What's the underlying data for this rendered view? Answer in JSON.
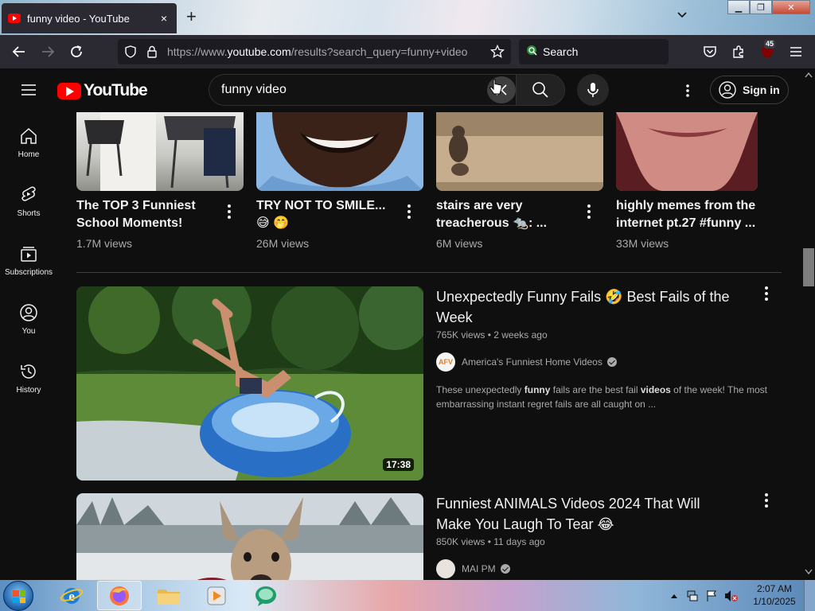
{
  "browser": {
    "tab_title": "funny video - YouTube",
    "tab_close": "×",
    "new_tab": "+",
    "url_prefix": "https://www.",
    "url_host": "youtube.com",
    "url_path": "/results?search_query=funny+video",
    "search_placeholder": "Search",
    "extension_badge": "45"
  },
  "youtube": {
    "logo_text": "YouTube",
    "search_query": "funny video",
    "sign_in": "Sign in",
    "sidebar": [
      {
        "label": "Home",
        "icon": "home-icon"
      },
      {
        "label": "Shorts",
        "icon": "shorts-icon"
      },
      {
        "label": "Subscriptions",
        "icon": "subscriptions-icon"
      },
      {
        "label": "You",
        "icon": "you-icon"
      },
      {
        "label": "History",
        "icon": "history-icon"
      }
    ],
    "shorts": [
      {
        "title": "The TOP 3 Funniest School Moments!",
        "views": "1.7M views"
      },
      {
        "title": "TRY NOT TO SMILE... 😅 🤭",
        "views": "26M views"
      },
      {
        "title": "stairs are very treacherous 🐀: ...",
        "views": "6M views"
      },
      {
        "title": "highly memes from the internet pt.27 #funny ...",
        "views": "33M views"
      }
    ],
    "videos": [
      {
        "title": "Unexpectedly Funny Fails 🤣 Best Fails of the Week",
        "meta": "765K views • 2 weeks ago",
        "channel": "America's Funniest Home Videos",
        "channel_avatar": "AFV",
        "desc_1": "These unexpectedly ",
        "desc_bold_1": "funny",
        "desc_2": " fails are the best fail ",
        "desc_bold_2": "videos",
        "desc_3": " of the week! The most embarrassing instant regret fails are all caught on ...",
        "duration": "17:38"
      },
      {
        "title": "Funniest ANIMALS Videos 2024 That Will Make You Laugh To Tear 😂",
        "meta": "850K views • 11 days ago",
        "channel": "MAI PM"
      }
    ]
  },
  "taskbar": {
    "time": "2:07 AM",
    "date": "1/10/2025"
  },
  "colors": {
    "yt_red": "#ff0000",
    "background": "#0f0f0f",
    "browser_chrome": "#2b2a33"
  }
}
